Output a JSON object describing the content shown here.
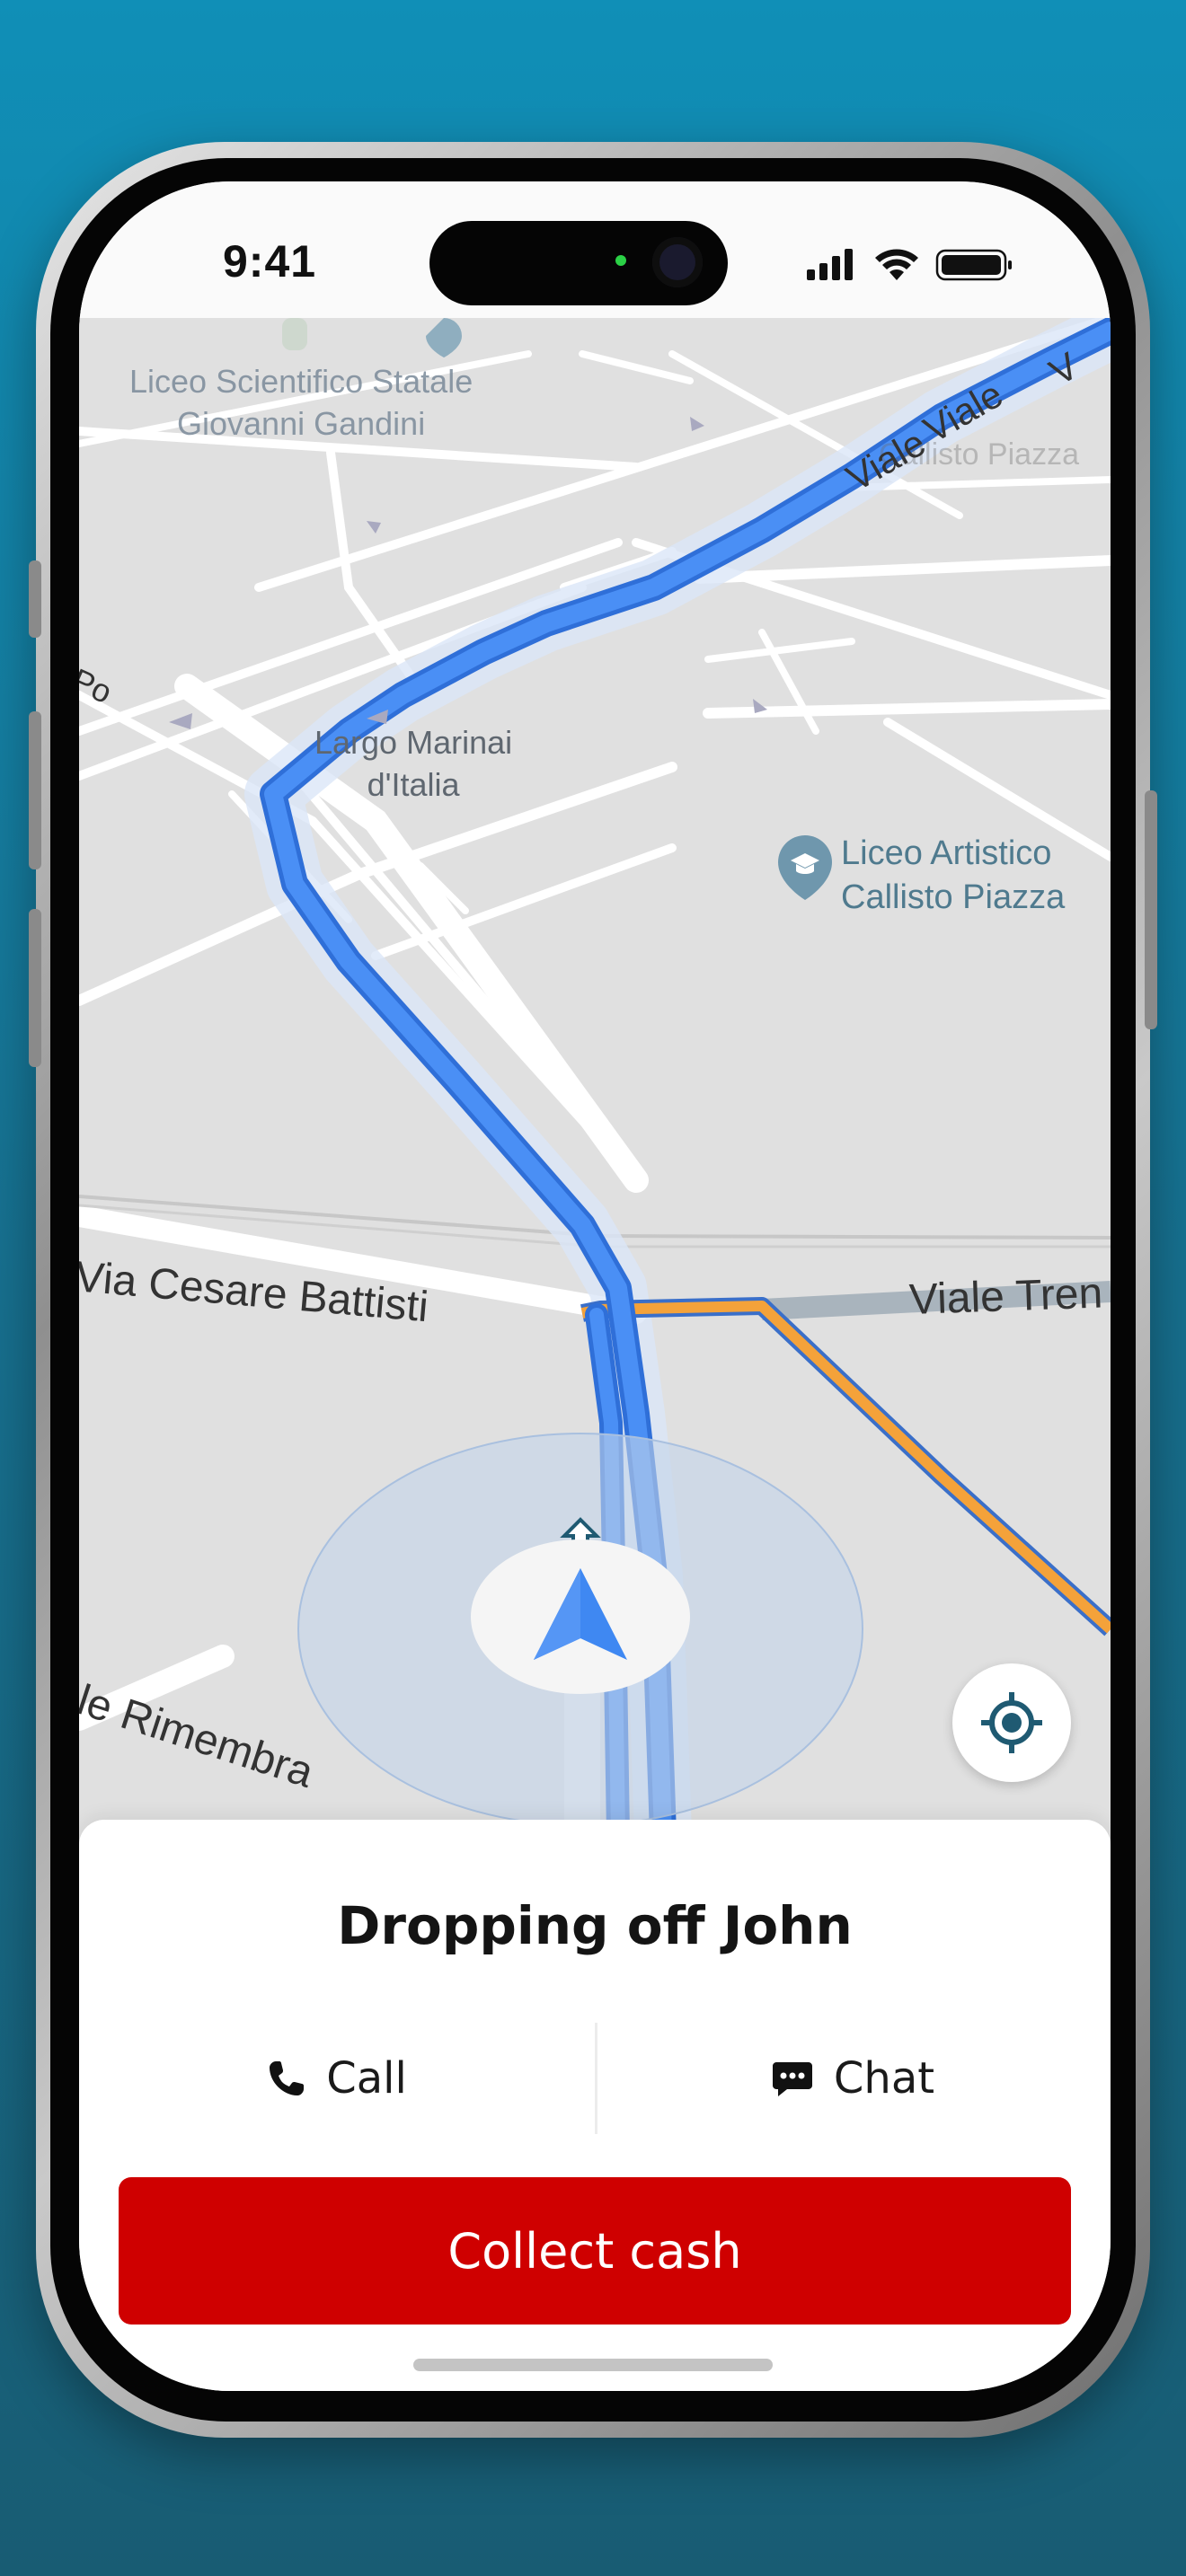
{
  "status_bar": {
    "time": "9:41"
  },
  "map": {
    "labels": {
      "school_statale_line1": "Liceo Scientifico Statale",
      "school_statale_line2": "Giovanni Gandini",
      "largo_line1": "Largo Marinai",
      "largo_line2": "d'Italia",
      "liceo_artistico_line1": "Liceo Artistico",
      "liceo_artistico_line2": "Callisto Piazza",
      "callisto_faded": "Callisto Piazza",
      "partial_left": "Po",
      "street_battisti": "Via Cesare Battisti",
      "street_viale_tren": "Viale Tren",
      "street_rimembranze": "le Rimembra",
      "street_viale_top": "Viale",
      "street_viale_top2": "Viale",
      "street_viale_top3": "V"
    },
    "colors": {
      "route": "#3e86f5",
      "alternate_route": "#f4a23a",
      "accuracy_circle": "#c8d7ea"
    }
  },
  "trip": {
    "title": "Dropping off John",
    "call_label": "Call",
    "chat_label": "Chat",
    "collect_label": "Collect cash"
  },
  "icons": {
    "call": "phone-icon",
    "chat": "chat-bubble-icon",
    "locate": "my-location-icon",
    "navigation": "navigation-arrow-icon"
  },
  "colors": {
    "primary_button": "#cf0000",
    "background_top": "#108fb7",
    "background_bottom": "#185c73"
  }
}
